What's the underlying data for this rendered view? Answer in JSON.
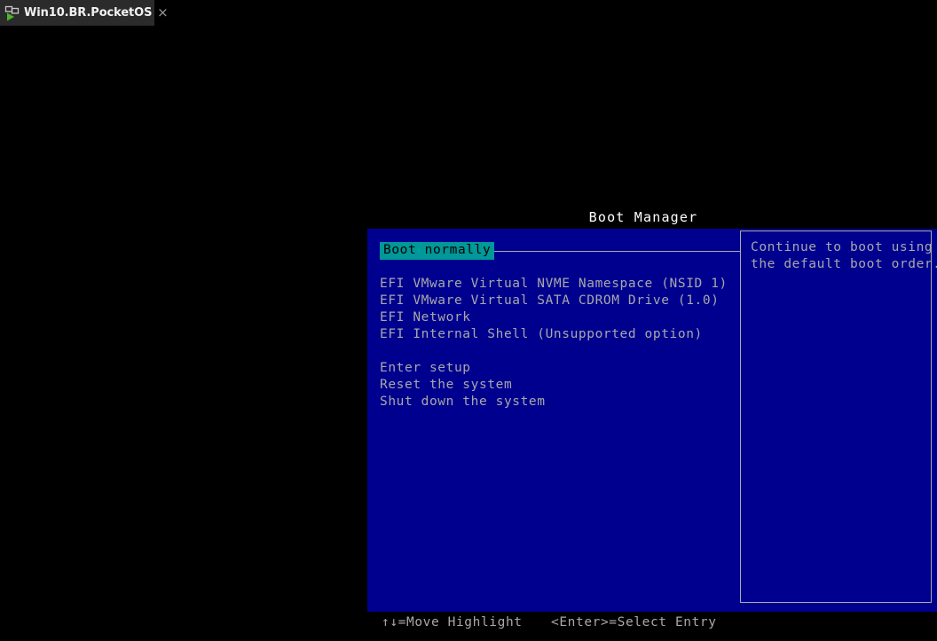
{
  "tab": {
    "title": "Win10.BR.PocketOS",
    "icon": "vm-play-icon",
    "close_label": "×"
  },
  "bios": {
    "title": "Boot Manager",
    "menu": [
      {
        "label": "Boot normally",
        "selected": true
      },
      {
        "label": "",
        "spacer": true
      },
      {
        "label": "EFI VMware Virtual NVME Namespace (NSID 1)",
        "selected": false
      },
      {
        "label": "EFI VMware Virtual SATA CDROM Drive (1.0)",
        "selected": false
      },
      {
        "label": "EFI Network",
        "selected": false
      },
      {
        "label": "EFI Internal Shell (Unsupported option)",
        "selected": false
      },
      {
        "label": "",
        "spacer": true
      },
      {
        "label": "Enter setup",
        "selected": false
      },
      {
        "label": "Reset the system",
        "selected": false
      },
      {
        "label": "Shut down the system",
        "selected": false
      }
    ],
    "help": {
      "line1": "Continue to boot using",
      "line2": "the default boot order."
    },
    "footer": {
      "move_hint": "↑↓=Move Highlight",
      "enter_hint": "<Enter>=Select Entry"
    }
  },
  "colors": {
    "panel_blue": "#00008f",
    "highlight_teal": "#009898",
    "text_gray": "#a8a8a8",
    "title_white": "#ffffff",
    "tab_bg": "#2b2b2b",
    "backdrop": "#000000"
  }
}
